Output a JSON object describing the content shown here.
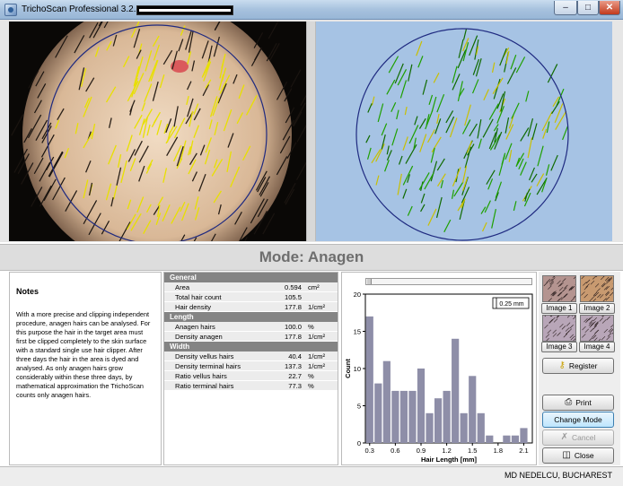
{
  "window": {
    "title": "TrichoScan Professional 3.2.12.82",
    "icons": {
      "minimize": "minimize-icon",
      "maximize": "maximize-icon",
      "close": "close-icon"
    }
  },
  "mode": {
    "label": "Mode: Anagen"
  },
  "notes": {
    "heading": "Notes",
    "text": "With a more precise and clipping independent procedure, anagen hairs can be analysed. For this purpose the hair in the target area must first be clipped completely to the skin surface with a standard single use hair clipper. After three days the hair in the area is dyed and analysed. As only anagen hairs grow considerably within these three days, by mathematical approximation the TrichoScan counts only anagen hairs."
  },
  "table": {
    "general": {
      "title": "General",
      "rows": [
        {
          "label": "Area",
          "value": "0.594",
          "unit": "cm²"
        },
        {
          "label": "Total hair count",
          "value": "105.5",
          "unit": ""
        },
        {
          "label": "Hair density",
          "value": "177.8",
          "unit": "1/cm²"
        }
      ]
    },
    "length": {
      "title": "Length",
      "rows": [
        {
          "label": "Anagen hairs",
          "value": "100.0",
          "unit": "%"
        },
        {
          "label": "Density anagen",
          "value": "177.8",
          "unit": "1/cm²"
        }
      ]
    },
    "width": {
      "title": "Width",
      "rows": [
        {
          "label": "Density vellus hairs",
          "value": "40.4",
          "unit": "1/cm²"
        },
        {
          "label": "Density terminal hairs",
          "value": "137.3",
          "unit": "1/cm²"
        },
        {
          "label": "Ratio vellus hairs",
          "value": "22.7",
          "unit": "%"
        },
        {
          "label": "Ratio terminal hairs",
          "value": "77.3",
          "unit": "%"
        }
      ]
    }
  },
  "chart_data": {
    "type": "bar",
    "xlabel": "Hair Length  [mm]",
    "ylabel": "Count",
    "ylim": [
      0,
      20
    ],
    "yticks": [
      0,
      5,
      10,
      15,
      20
    ],
    "xticks": [
      "0.3",
      "0.6",
      "0.9",
      "1.2",
      "1.5",
      "1.8",
      "2.1"
    ],
    "bin_width_label": "0.25 mm",
    "x": [
      0.3,
      0.4,
      0.5,
      0.6,
      0.7,
      0.8,
      0.9,
      1.0,
      1.1,
      1.2,
      1.3,
      1.4,
      1.5,
      1.6,
      1.7,
      1.8,
      1.9,
      2.0,
      2.1
    ],
    "values": [
      17,
      8,
      11,
      7,
      7,
      7,
      10,
      4,
      6,
      7,
      14,
      4,
      9,
      4,
      1,
      0,
      1,
      1,
      2
    ],
    "bar_color": "#8e8ea8"
  },
  "thumbnails": [
    {
      "label": "Image 1"
    },
    {
      "label": "Image 2"
    },
    {
      "label": "Image 3"
    },
    {
      "label": "Image 4"
    }
  ],
  "buttons": {
    "register": "Register",
    "print": "Print",
    "change_mode": "Change Mode",
    "cancel": "Cancel",
    "close": "Close"
  },
  "status": {
    "credit": "MD NEDELCU, BUCHAREST"
  },
  "colors": {
    "yellow_marking": "#e8e000",
    "green_marking": "#1ea000",
    "circle": "#1f2a80",
    "right_bg": "#a6c3e4"
  }
}
